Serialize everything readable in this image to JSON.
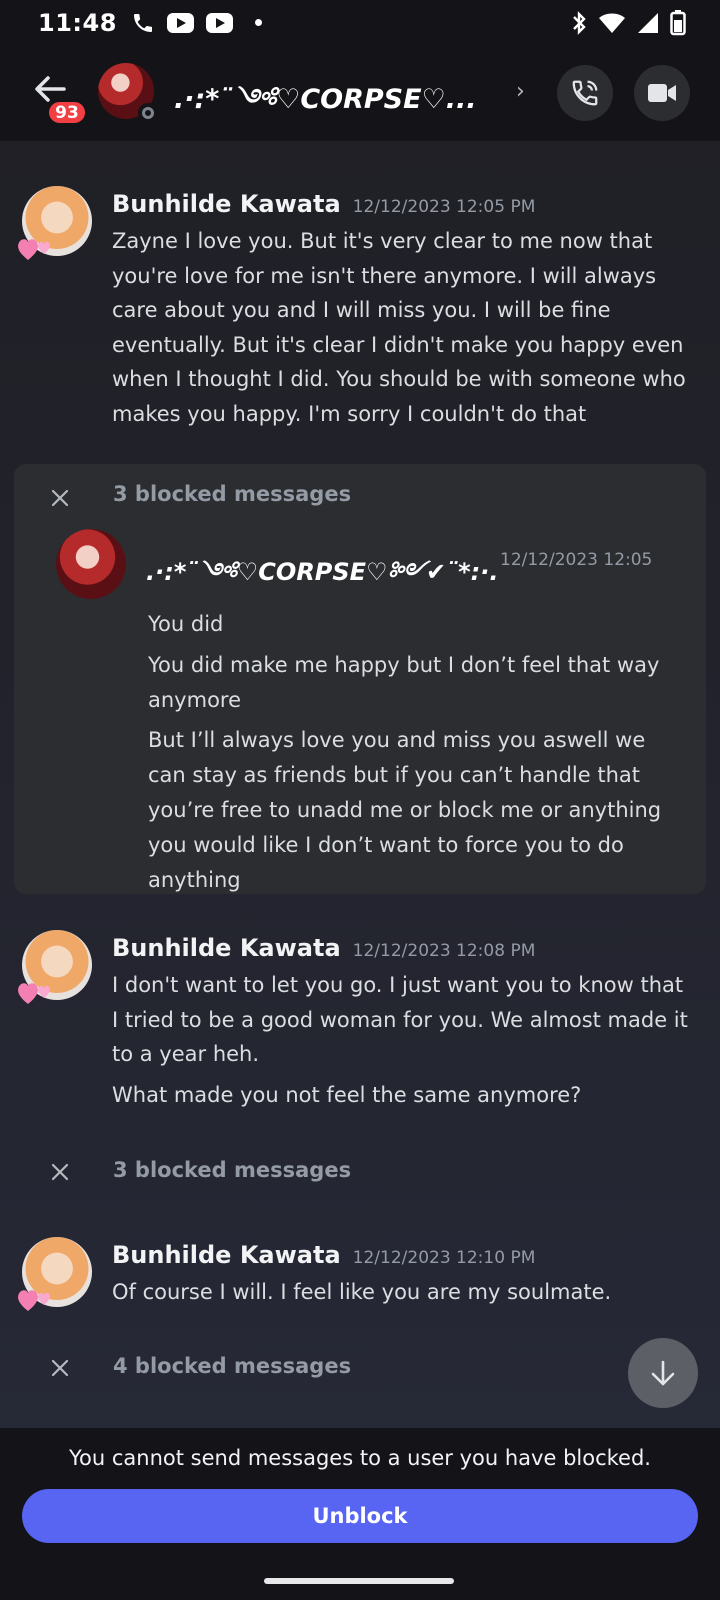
{
  "status_bar": {
    "time": "11:48"
  },
  "header": {
    "notification_count": "93",
    "channel_name": ".·:*¨༺♡CORPSE♡...",
    "chevron": "›"
  },
  "messages": [
    {
      "author": "Bunhilde Kawata",
      "timestamp": "12/12/2023 12:05 PM",
      "text": "Zayne I love you. But it's very clear to me now that you're love for me isn't there anymore. I will always care about you and I will miss you. I will be fine eventually. But it's clear I didn't make you happy even when I thought I did. You should be with someone who makes you happy. I'm sorry I couldn't do that"
    },
    {
      "author": "Bunhilde Kawata",
      "timestamp": "12/12/2023 12:08 PM",
      "text": "I don't want to let you go. I just want you to know that I tried to be a good woman for you. We almost made it to a year heh.",
      "text2": "What made you not feel the same anymore?"
    },
    {
      "author": "Bunhilde Kawata",
      "timestamp": "12/12/2023 12:10 PM",
      "text": "Of course I will. I feel like you are my soulmate."
    }
  ],
  "blocked_expanded": {
    "label": "3 blocked messages",
    "author": ".·:*¨༺♡CORPSE♡༻✔¨*:·.",
    "timestamp": "12/12/2023 12:05",
    "lines": [
      "You did",
      "You did make me happy but I don’t feel that way anymore",
      "But I’ll always love you and miss you aswell we can stay as friends but if you can’t handle that you’re free to unadd me or block me or anything you would like I don’t want to force you to do anything"
    ]
  },
  "blocked_collapsed": [
    {
      "label": "3 blocked messages"
    },
    {
      "label": "4 blocked messages"
    }
  ],
  "footer": {
    "note": "You cannot send messages to a user you have blocked.",
    "unblock_label": "Unblock"
  },
  "colors": {
    "accent": "#5865f2",
    "badge": "#f23f43",
    "bar_bg": "#131318",
    "panel_bg": "#2b2d31"
  }
}
